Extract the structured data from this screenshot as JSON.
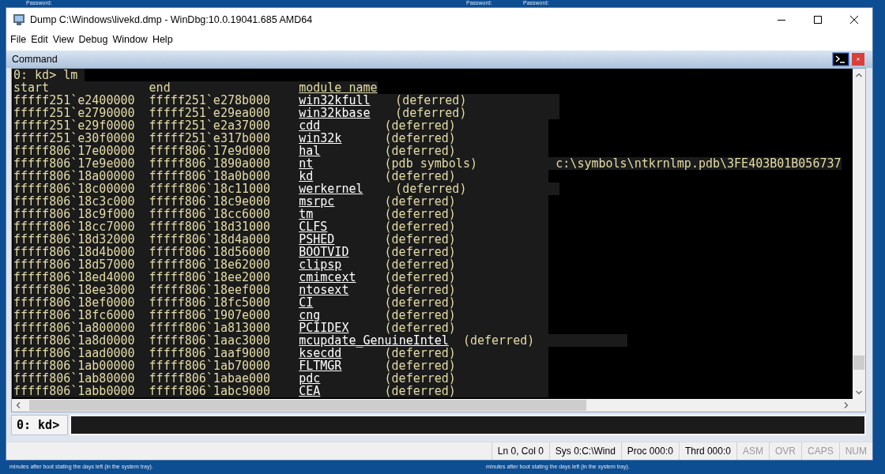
{
  "desktop": {
    "top_labels": [
      "Password:",
      "Password:",
      "Password:"
    ],
    "bottom_labels": [
      "minutes after boot stating the days left (in the system tray).",
      "minutes after boot stating the days left (in the system tray)."
    ]
  },
  "window": {
    "title": "Dump C:\\Windows\\livekd.dmp - WinDbg:10.0.19041.685 AMD64"
  },
  "menu": [
    "File",
    "Edit",
    "View",
    "Debug",
    "Window",
    "Help"
  ],
  "command_panel": {
    "title": "Command",
    "output": {
      "prompt": "0: kd> lm",
      "columns": [
        "start",
        "end",
        "module name"
      ],
      "rows": [
        {
          "start": "fffff251`e2400000",
          "end": "fffff251`e278b000",
          "module": "win32kfull",
          "status": "(deferred)"
        },
        {
          "start": "fffff251`e2790000",
          "end": "fffff251`e29ea000",
          "module": "win32kbase",
          "status": "(deferred)"
        },
        {
          "start": "fffff251`e29f0000",
          "end": "fffff251`e2a37000",
          "module": "cdd",
          "status": "(deferred)"
        },
        {
          "start": "fffff251`e30f0000",
          "end": "fffff251`e317b000",
          "module": "win32k",
          "status": "(deferred)"
        },
        {
          "start": "fffff806`17e00000",
          "end": "fffff806`17e9d000",
          "module": "hal",
          "status": "(deferred)"
        },
        {
          "start": "fffff806`17e9e000",
          "end": "fffff806`1890a000",
          "module": "nt",
          "status": "(pdb symbols)",
          "path": "c:\\symbols\\ntkrnlmp.pdb\\3FE403B01B056737"
        },
        {
          "start": "fffff806`18a00000",
          "end": "fffff806`18a0b000",
          "module": "kd",
          "status": "(deferred)"
        },
        {
          "start": "fffff806`18c00000",
          "end": "fffff806`18c11000",
          "module": "werkernel",
          "status": "(deferred)"
        },
        {
          "start": "fffff806`18c3c000",
          "end": "fffff806`18c9e000",
          "module": "msrpc",
          "status": "(deferred)"
        },
        {
          "start": "fffff806`18c9f000",
          "end": "fffff806`18cc6000",
          "module": "tm",
          "status": "(deferred)"
        },
        {
          "start": "fffff806`18cc7000",
          "end": "fffff806`18d31000",
          "module": "CLFS",
          "status": "(deferred)"
        },
        {
          "start": "fffff806`18d32000",
          "end": "fffff806`18d4a000",
          "module": "PSHED",
          "status": "(deferred)"
        },
        {
          "start": "fffff806`18d4b000",
          "end": "fffff806`18d56000",
          "module": "BOOTVID",
          "status": "(deferred)"
        },
        {
          "start": "fffff806`18d57000",
          "end": "fffff806`18e62000",
          "module": "clipsp",
          "status": "(deferred)"
        },
        {
          "start": "fffff806`18ed4000",
          "end": "fffff806`18ee2000",
          "module": "cmimcext",
          "status": "(deferred)"
        },
        {
          "start": "fffff806`18ee3000",
          "end": "fffff806`18eef000",
          "module": "ntosext",
          "status": "(deferred)"
        },
        {
          "start": "fffff806`18ef0000",
          "end": "fffff806`18fc5000",
          "module": "CI",
          "status": "(deferred)"
        },
        {
          "start": "fffff806`18fc6000",
          "end": "fffff806`1907e000",
          "module": "cng",
          "status": "(deferred)"
        },
        {
          "start": "fffff806`1a800000",
          "end": "fffff806`1a813000",
          "module": "PCIIDEX",
          "status": "(deferred)"
        },
        {
          "start": "fffff806`1a8d0000",
          "end": "fffff806`1aac3000",
          "module": "mcupdate_GenuineIntel",
          "status": "(deferred)"
        },
        {
          "start": "fffff806`1aad0000",
          "end": "fffff806`1aaf9000",
          "module": "ksecdd",
          "status": "(deferred)"
        },
        {
          "start": "fffff806`1ab00000",
          "end": "fffff806`1ab70000",
          "module": "FLTMGR",
          "status": "(deferred)"
        },
        {
          "start": "fffff806`1ab80000",
          "end": "fffff806`1abae000",
          "module": "pdc",
          "status": "(deferred)"
        },
        {
          "start": "fffff806`1abb0000",
          "end": "fffff806`1abc9000",
          "module": "CEA",
          "status": "(deferred)"
        }
      ]
    },
    "input": {
      "prompt": "0: kd>"
    }
  },
  "status_bar": {
    "fields": [
      "Ln 0, Col 0",
      "Sys 0:C:\\Wind",
      "Proc 000:0",
      "Thrd 000:0"
    ],
    "indicators": [
      {
        "label": "ASM",
        "active": false
      },
      {
        "label": "OVR",
        "active": false
      },
      {
        "label": "CAPS",
        "active": false
      },
      {
        "label": "NUM",
        "active": false
      }
    ]
  }
}
